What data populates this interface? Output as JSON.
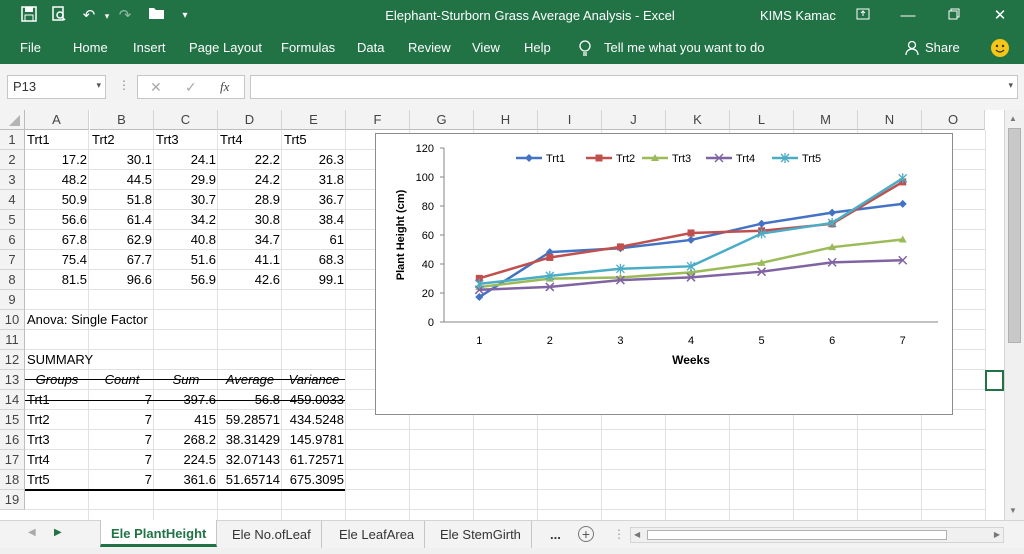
{
  "window": {
    "title": "Elephant-Sturborn Grass Average Analysis  -  Excel",
    "user": "KIMS Kamac"
  },
  "ribbon": {
    "tabs": [
      "File",
      "Home",
      "Insert",
      "Page Layout",
      "Formulas",
      "Data",
      "Review",
      "View",
      "Help"
    ],
    "tell_me": "Tell me what you want to do",
    "share": "Share"
  },
  "formula_bar": {
    "name_box": "P13",
    "fx": "fx",
    "content": ""
  },
  "sheet": {
    "columns": [
      "A",
      "B",
      "C",
      "D",
      "E",
      "F",
      "G",
      "H",
      "I",
      "J",
      "K",
      "L",
      "M",
      "N",
      "O"
    ],
    "rows": [
      "1",
      "2",
      "3",
      "4",
      "5",
      "6",
      "7",
      "8",
      "9",
      "10",
      "11",
      "12",
      "13",
      "14",
      "15",
      "16",
      "17",
      "18",
      "19"
    ],
    "headers": [
      "Trt1",
      "Trt2",
      "Trt3",
      "Trt4",
      "Trt5"
    ],
    "data": [
      [
        "17.2",
        "30.1",
        "24.1",
        "22.2",
        "26.3"
      ],
      [
        "48.2",
        "44.5",
        "29.9",
        "24.2",
        "31.8"
      ],
      [
        "50.9",
        "51.8",
        "30.7",
        "28.9",
        "36.7"
      ],
      [
        "56.6",
        "61.4",
        "34.2",
        "30.8",
        "38.4"
      ],
      [
        "67.8",
        "62.9",
        "40.8",
        "34.7",
        "61"
      ],
      [
        "75.4",
        "67.7",
        "51.6",
        "41.1",
        "68.3"
      ],
      [
        "81.5",
        "96.6",
        "56.9",
        "42.6",
        "99.1"
      ]
    ],
    "anova_title": "Anova: Single Factor",
    "summary_label": "SUMMARY",
    "summary_headers": [
      "Groups",
      "Count",
      "Sum",
      "Average",
      "Variance"
    ],
    "summary_rows": [
      [
        "Trt1",
        "7",
        "397.6",
        "56.8",
        "459.0033"
      ],
      [
        "Trt2",
        "7",
        "415",
        "59.28571",
        "434.5248"
      ],
      [
        "Trt3",
        "7",
        "268.2",
        "38.31429",
        "145.9781"
      ],
      [
        "Trt4",
        "7",
        "224.5",
        "32.07143",
        "61.72571"
      ],
      [
        "Trt5",
        "7",
        "361.6",
        "51.65714",
        "675.3095"
      ]
    ]
  },
  "sheet_tabs": {
    "items": [
      "Ele PlantHeight",
      "Ele No.ofLeaf",
      "Ele LeafArea",
      "Ele StemGirth"
    ],
    "active": "Ele PlantHeight",
    "more": "..."
  },
  "chart_data": {
    "type": "line",
    "x": [
      1,
      2,
      3,
      4,
      5,
      6,
      7
    ],
    "xlabel": "Weeks",
    "ylabel": "Plant Height (cm)",
    "ylim": [
      0,
      120
    ],
    "yticks": [
      0,
      20,
      40,
      60,
      80,
      100,
      120
    ],
    "legend": "top",
    "grid": false,
    "series": [
      {
        "name": "Trt1",
        "values": [
          17.2,
          48.2,
          50.9,
          56.6,
          67.8,
          75.4,
          81.5
        ],
        "color": "#4472c4",
        "marker": "diamond"
      },
      {
        "name": "Trt2",
        "values": [
          30.1,
          44.5,
          51.8,
          61.4,
          62.9,
          67.7,
          96.6
        ],
        "color": "#c0504d",
        "marker": "square"
      },
      {
        "name": "Trt3",
        "values": [
          24.1,
          29.9,
          30.7,
          34.2,
          40.8,
          51.6,
          56.9
        ],
        "color": "#9bbb59",
        "marker": "triangle"
      },
      {
        "name": "Trt4",
        "values": [
          22.2,
          24.2,
          28.9,
          30.8,
          34.7,
          41.1,
          42.6
        ],
        "color": "#8064a2",
        "marker": "x"
      },
      {
        "name": "Trt5",
        "values": [
          26.3,
          31.8,
          36.7,
          38.4,
          61,
          68.3,
          99.1
        ],
        "color": "#4bacc6",
        "marker": "star"
      }
    ]
  }
}
